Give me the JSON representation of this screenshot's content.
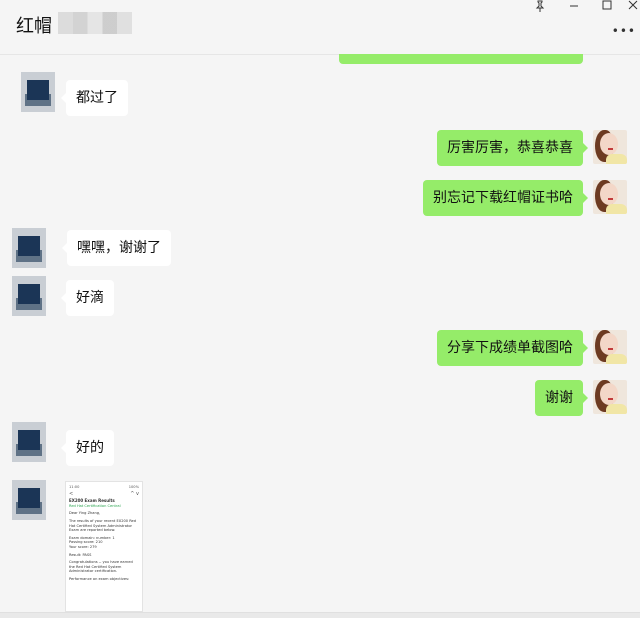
{
  "header": {
    "title": "红帽",
    "pin_icon": "pin-icon",
    "minimize_icon": "minimize-icon",
    "maximize_icon": "maximize-icon",
    "close_icon": "close-icon",
    "more_icon": "more-dots-icon"
  },
  "messages": [
    {
      "side": "left",
      "text": "都过了"
    },
    {
      "side": "right",
      "text": "厉害厉害，恭喜恭喜"
    },
    {
      "side": "right",
      "text": "别忘记下载红帽证书哈"
    },
    {
      "side": "left",
      "text": "嘿嘿，谢谢了"
    },
    {
      "side": "left",
      "text": "好滴"
    },
    {
      "side": "right",
      "text": "分享下成绩单截图哈"
    },
    {
      "side": "right",
      "text": "谢谢"
    },
    {
      "side": "left",
      "text": "好的"
    }
  ],
  "screenshot_card": {
    "status_left": "11:00",
    "status_right": "100%",
    "back": "<",
    "nav_right": "^  v",
    "heading": "EX200 Exam Results",
    "from": "Red Hat Certification Central",
    "greeting": "Dear Ying Zhang,",
    "body1": "The results of your recent EX200 Red Hat Certified System Administrator Exam are reported below.",
    "domain": "Exam domain: number: 1",
    "passing": "Passing score: 210",
    "score": "Your score: 279",
    "result": "Result: PASS",
    "congrats": "Congratulations -- you have earned the Red Hat Certified System Administrator certification.",
    "perf": "Performance on exam objectives:"
  },
  "colors": {
    "sent_bubble": "#95ec69",
    "received_bubble": "#ffffff",
    "background": "#f5f5f5"
  }
}
